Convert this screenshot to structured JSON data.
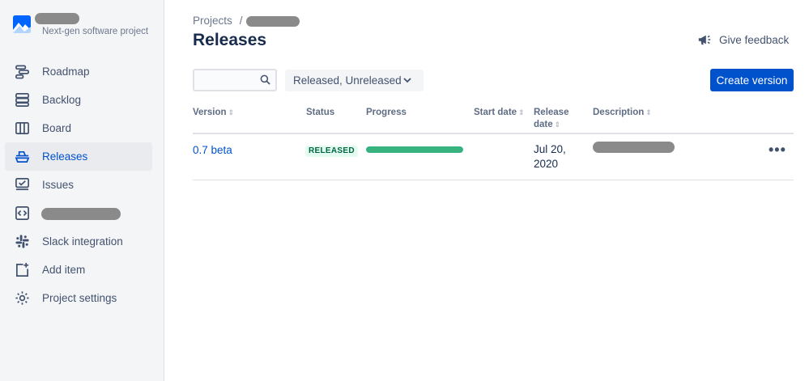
{
  "sidebar": {
    "project_type": "Next-gen software project",
    "items": [
      {
        "label": "Roadmap",
        "icon": "roadmap-icon",
        "active": false
      },
      {
        "label": "Backlog",
        "icon": "backlog-icon",
        "active": false
      },
      {
        "label": "Board",
        "icon": "board-icon",
        "active": false
      },
      {
        "label": "Releases",
        "icon": "releases-icon",
        "active": true
      },
      {
        "label": "Issues",
        "icon": "issues-icon",
        "active": false
      },
      {
        "label": "",
        "icon": "code-icon",
        "active": false
      },
      {
        "label": "Slack integration",
        "icon": "slack-icon",
        "active": false
      },
      {
        "label": "Add item",
        "icon": "add-item-icon",
        "active": false
      },
      {
        "label": "Project settings",
        "icon": "gear-icon",
        "active": false
      }
    ]
  },
  "header": {
    "breadcrumb_root": "Projects",
    "breadcrumb_sep": "/",
    "title": "Releases",
    "feedback_label": "Give feedback"
  },
  "toolbar": {
    "search_value": "",
    "filter_label": "Released, Unreleased",
    "create_label": "Create version"
  },
  "table": {
    "columns": {
      "version": "Version",
      "status": "Status",
      "progress": "Progress",
      "start_date": "Start date",
      "release_date_1": "Release",
      "release_date_2": "date",
      "description": "Description"
    },
    "rows": [
      {
        "version": "0.7 beta",
        "status": "RELEASED",
        "progress": 1.0,
        "start_date": "",
        "release_date": "Jul 20, 2020",
        "description": ""
      }
    ]
  },
  "colors": {
    "primary": "#0052CC",
    "success": "#36B37E",
    "lozenge_bg": "#E3FCEF",
    "lozenge_text": "#006644",
    "sidebar_bg": "#F4F5F7"
  }
}
